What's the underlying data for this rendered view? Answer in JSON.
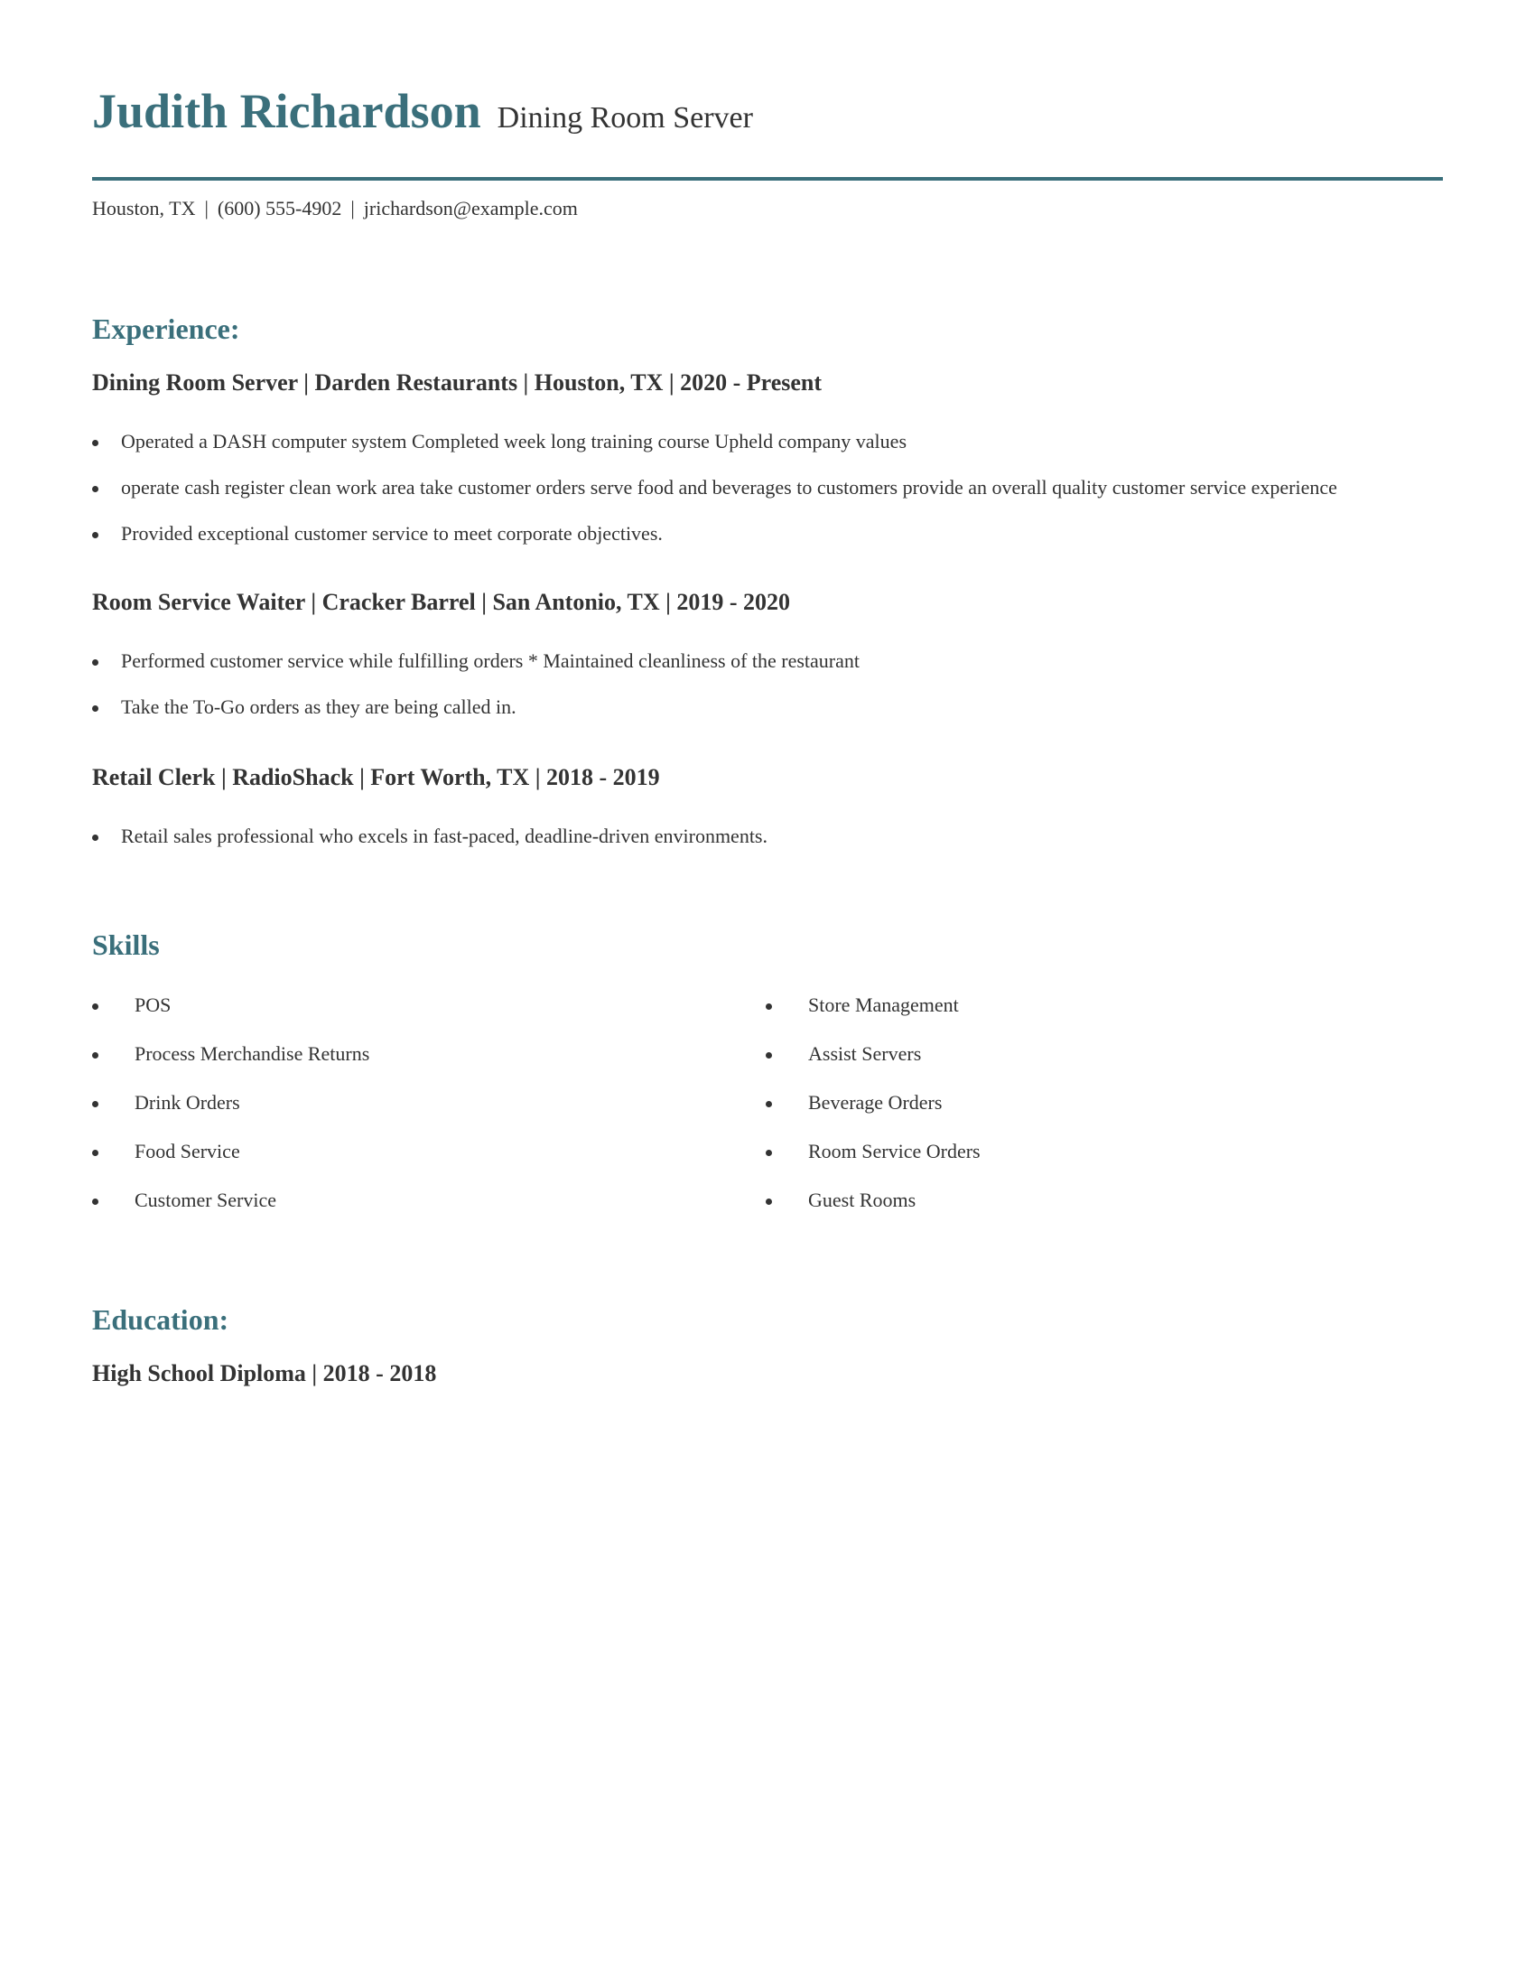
{
  "header": {
    "name": "Judith Richardson",
    "title": "Dining Room Server",
    "contact": {
      "location": "Houston, TX",
      "phone": "(600) 555-4902",
      "email": "jrichardson@example.com",
      "separator": "|"
    }
  },
  "experience": {
    "heading": "Experience:",
    "jobs": [
      {
        "header": "Dining Room Server | Darden Restaurants | Houston, TX |  2020 - Present",
        "bullets": [
          "Operated a DASH computer system Completed week long training course Upheld company values",
          "operate cash register clean work area take customer orders serve food and beverages to customers provide an overall quality customer service experience",
          "Provided exceptional customer service to meet corporate objectives."
        ]
      },
      {
        "header": "Room Service Waiter | Cracker Barrel | San Antonio, TX |  2019 - 2020",
        "bullets": [
          "Performed customer service while fulfilling orders * Maintained cleanliness of the restaurant",
          "Take the To-Go orders as they are being called in."
        ]
      },
      {
        "header": "Retail Clerk | RadioShack | Fort Worth, TX |  2018 - 2019",
        "bullets": [
          "Retail sales professional who excels in fast-paced, deadline-driven environments."
        ]
      }
    ]
  },
  "skills": {
    "heading": "Skills",
    "left": [
      "POS",
      "Process Merchandise Returns",
      "Drink Orders",
      "Food Service",
      "Customer Service"
    ],
    "right": [
      "Store Management",
      "Assist Servers",
      "Beverage Orders",
      "Room Service Orders",
      "Guest Rooms"
    ]
  },
  "education": {
    "heading": "Education:",
    "entries": [
      "High School Diploma |  2018 - 2018"
    ]
  },
  "colors": {
    "accent": "#3a6f7b",
    "text": "#333333"
  }
}
